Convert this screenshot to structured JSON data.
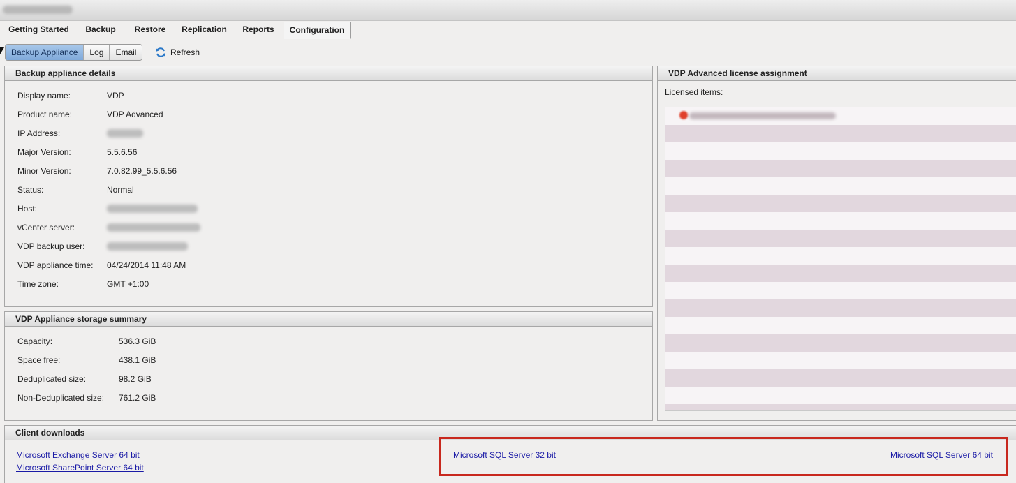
{
  "window": {
    "title": "VDP Advanced"
  },
  "tabs": [
    {
      "label": "Getting Started"
    },
    {
      "label": "Backup"
    },
    {
      "label": "Restore"
    },
    {
      "label": "Replication"
    },
    {
      "label": "Reports"
    },
    {
      "label": "Configuration",
      "active": true
    }
  ],
  "subtabs": [
    {
      "label": "Backup Appliance",
      "active": true
    },
    {
      "label": "Log"
    },
    {
      "label": "Email"
    }
  ],
  "toolbar": {
    "refresh_label": "Refresh",
    "refresh_icon": "refresh-icon"
  },
  "appliance_details": {
    "title": "Backup appliance details",
    "rows": [
      {
        "label": "Display name:",
        "value": "VDP"
      },
      {
        "label": "Product name:",
        "value": "VDP Advanced"
      },
      {
        "label": "IP Address:",
        "value": ""
      },
      {
        "label": "Major Version:",
        "value": "5.5.6.56"
      },
      {
        "label": "Minor Version:",
        "value": "7.0.82.99_5.5.6.56"
      },
      {
        "label": "Status:",
        "value": "Normal"
      },
      {
        "label": "Host:",
        "value": ""
      },
      {
        "label": "vCenter server:",
        "value": ""
      },
      {
        "label": "VDP backup user:",
        "value": ""
      },
      {
        "label": "VDP appliance time:",
        "value": "04/24/2014 11:48 AM"
      },
      {
        "label": "Time zone:",
        "value": "GMT +1:00"
      }
    ]
  },
  "storage_summary": {
    "title": "VDP Appliance storage summary",
    "rows": [
      {
        "label": "Capacity:",
        "value": "536.3 GiB"
      },
      {
        "label": "Space free:",
        "value": "438.1 GiB"
      },
      {
        "label": "Deduplicated size:",
        "value": "98.2 GiB"
      },
      {
        "label": "Non-Deduplicated size:",
        "value": "761.2 GiB"
      }
    ]
  },
  "license": {
    "title": "VDP Advanced license assignment",
    "licensed_label": "Licensed items:"
  },
  "client_downloads": {
    "title": "Client downloads",
    "links": [
      {
        "label": "Microsoft Exchange Server 64 bit"
      },
      {
        "label": "Microsoft SharePoint Server 64 bit"
      },
      {
        "label": "Microsoft SQL Server 32 bit"
      },
      {
        "label": "Microsoft SQL Server 64 bit"
      }
    ]
  },
  "colors": {
    "highlight": "#c8281e",
    "active_subtab": "#8fb4e0",
    "link": "#1a1aa6"
  }
}
